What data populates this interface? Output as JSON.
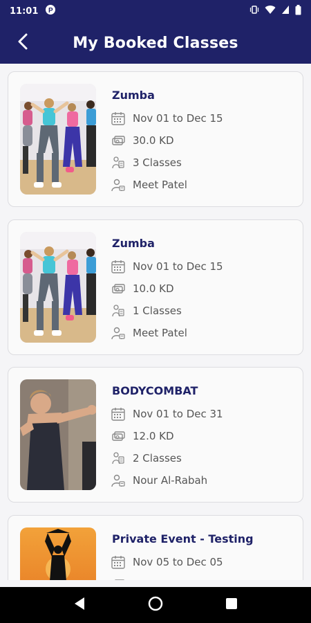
{
  "status_bar": {
    "time": "11:01"
  },
  "header": {
    "title": "My Booked Classes"
  },
  "classes": [
    {
      "title": "Zumba",
      "dates": "Nov 01 to Dec 15",
      "price": "30.0 KD",
      "count": "3 Classes",
      "instructor": "Meet Patel",
      "image_icon": "zumba-group-image"
    },
    {
      "title": "Zumba",
      "dates": "Nov 01 to Dec 15",
      "price": "10.0 KD",
      "count": "1 Classes",
      "instructor": "Meet Patel",
      "image_icon": "zumba-group-image"
    },
    {
      "title": "BODYCOMBAT",
      "dates": "Nov 01 to Dec 31",
      "price": "12.0 KD",
      "count": "2 Classes",
      "instructor": "Nour Al-Rabah",
      "image_icon": "boxing-woman-image"
    },
    {
      "title": "Private Event - Testing",
      "dates": "Nov 05 to Dec 05",
      "image_icon": "yoga-sunset-image"
    }
  ],
  "icons": {
    "back": "back-arrow-icon",
    "date": "calendar-icon",
    "price": "money-icon",
    "count": "classes-icon",
    "instructor": "person-icon"
  },
  "colors": {
    "primary": "#1f2268",
    "card_bg": "#fafafa",
    "text_secondary": "#555555"
  }
}
